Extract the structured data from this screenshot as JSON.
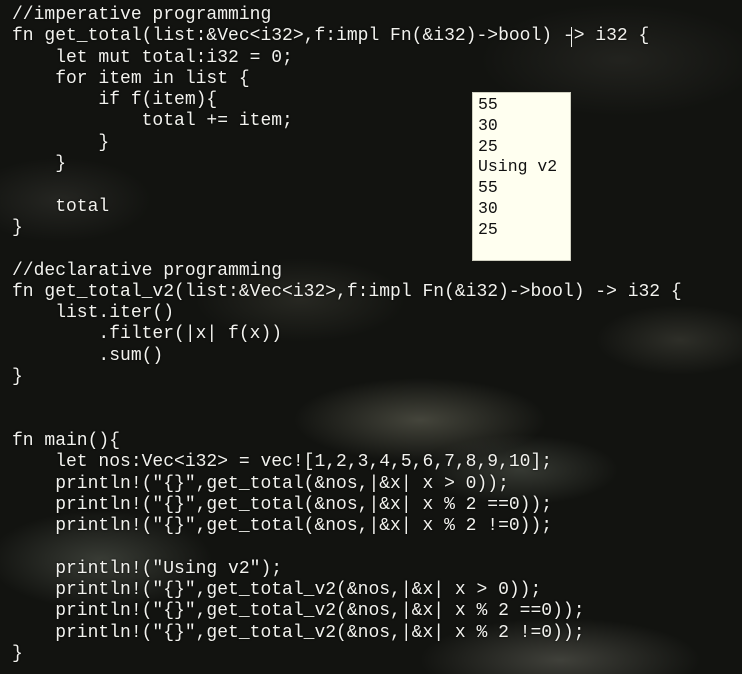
{
  "code_lines": [
    "//imperative programming",
    "fn get_total(list:&Vec<i32>,f:impl Fn(&i32)->bool) -> i32 {",
    "    let mut total:i32 = 0;",
    "    for item in list {",
    "        if f(item){",
    "            total += item;",
    "        }",
    "    }",
    "",
    "    total",
    "}",
    "",
    "//declarative programming",
    "fn get_total_v2(list:&Vec<i32>,f:impl Fn(&i32)->bool) -> i32 {",
    "    list.iter()",
    "        .filter(|x| f(x))",
    "        .sum()",
    "}",
    "",
    "",
    "fn main(){",
    "    let nos:Vec<i32> = vec![1,2,3,4,5,6,7,8,9,10];",
    "    println!(\"{}\",get_total(&nos,|&x| x > 0));",
    "    println!(\"{}\",get_total(&nos,|&x| x % 2 ==0));",
    "    println!(\"{}\",get_total(&nos,|&x| x % 2 !=0));",
    "",
    "    println!(\"Using v2\");",
    "    println!(\"{}\",get_total_v2(&nos,|&x| x > 0));",
    "    println!(\"{}\",get_total_v2(&nos,|&x| x % 2 ==0));",
    "    println!(\"{}\",get_total_v2(&nos,|&x| x % 2 !=0));",
    "}"
  ],
  "output_lines": [
    "55",
    "30",
    "25",
    "Using v2",
    "55",
    "30",
    "25"
  ]
}
